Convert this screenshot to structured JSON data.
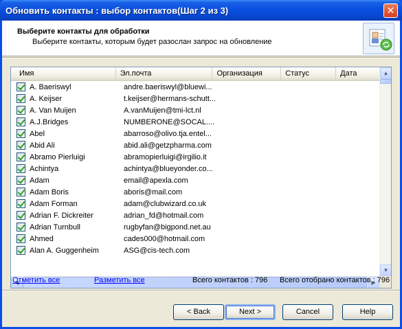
{
  "window": {
    "title": "Обновить контакты : выбор контактов(Шаг 2 из 3)",
    "close_label": "✕"
  },
  "header": {
    "title": "Выберите контакты для обработки",
    "subtitle": "Выберите контакты, которым будет разослан запрос на обновление",
    "icon": "contacts-refresh-icon"
  },
  "list": {
    "columns": [
      "Имя",
      "Эл.почта",
      "Организация",
      "Статус",
      "Дата"
    ],
    "rows": [
      {
        "name": "A. Baeriswyl",
        "email": "andre.baeriswyl@bluewi...",
        "checked": true
      },
      {
        "name": "A. Keijser",
        "email": "t.keijser@hermans-schutt...",
        "checked": true
      },
      {
        "name": "A. Van Muijen",
        "email": "A.vanMuijen@tmi-lct.nl",
        "checked": true
      },
      {
        "name": "A.J.Bridges",
        "email": "NUMBERONE@SOCAL....",
        "checked": true
      },
      {
        "name": "Abel",
        "email": "abarroso@olivo.tja.entel...",
        "checked": true
      },
      {
        "name": "Abid Ali",
        "email": "abid.ali@getzpharma.com",
        "checked": true
      },
      {
        "name": "Abramo Pierluigi",
        "email": "abramopierluigi@irgilio.it",
        "checked": true
      },
      {
        "name": "Achintya",
        "email": "achintya@blueyonder.co...",
        "checked": true
      },
      {
        "name": "Adam",
        "email": "email@apexla.com",
        "checked": true
      },
      {
        "name": "Adam Boris",
        "email": "aboris@mail.com",
        "checked": true
      },
      {
        "name": "Adam Forman",
        "email": "adam@clubwizard.co.uk",
        "checked": true
      },
      {
        "name": "Adrian F. Dickreiter",
        "email": "adrian_fd@hotmail.com",
        "checked": true
      },
      {
        "name": "Adrian Turnbull",
        "email": "rugbyfan@bigpond.net.au",
        "checked": true
      },
      {
        "name": "Ahmed",
        "email": "cades000@hotmail.com",
        "checked": true
      },
      {
        "name": "Alan A. Guggenheim",
        "email": "ASG@cis-tech.com",
        "checked": true
      }
    ]
  },
  "links": {
    "check_all": "Отметить все",
    "uncheck_all": "Разметить все"
  },
  "stats": {
    "total_contacts": "Всего контактов : 796",
    "total_selected": "Всего отобрано контактов : 796"
  },
  "buttons": {
    "back": "< Back",
    "next": "Next >",
    "cancel": "Cancel",
    "help": "Help"
  }
}
